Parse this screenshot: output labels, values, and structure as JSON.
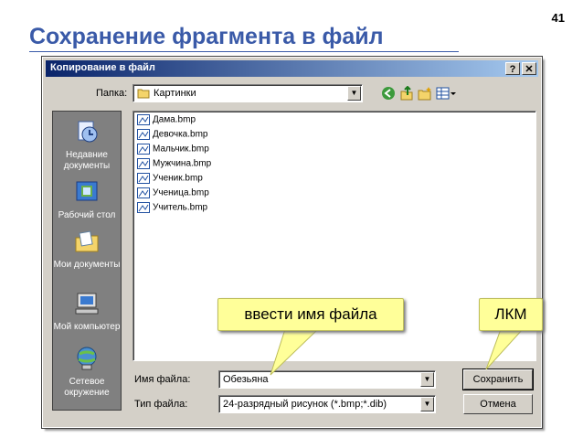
{
  "slide": {
    "title": "Сохранение фрагмента в файл",
    "number": "41"
  },
  "dialog": {
    "title": "Копирование в файл",
    "help_button": "?",
    "close_button": "✕",
    "folder_label": "Папка:",
    "folder_value": "Картинки",
    "places": [
      {
        "label": "Недавние документы",
        "icon": "recent-documents-icon"
      },
      {
        "label": "Рабочий стол",
        "icon": "desktop-icon"
      },
      {
        "label": "Мои документы",
        "icon": "my-documents-icon"
      },
      {
        "label": "Мой компьютер",
        "icon": "my-computer-icon"
      },
      {
        "label": "Сетевое окружение",
        "icon": "network-icon"
      }
    ],
    "files": [
      "Дама.bmp",
      "Девочка.bmp",
      "Мальчик.bmp",
      "Мужчина.bmp",
      "Ученик.bmp",
      "Ученица.bmp",
      "Учитель.bmp"
    ],
    "filename_label": "Имя файла:",
    "filename_value": "Обезьяна",
    "filetype_label": "Тип файла:",
    "filetype_value": "24-разрядный рисунок (*.bmp;*.dib)",
    "save_button": "Сохранить",
    "cancel_button": "Отмена"
  },
  "callouts": {
    "enter_name": "ввести имя файла",
    "click": "ЛКМ"
  },
  "colors": {
    "title": "#3a5aa8",
    "callout": "#ffff99",
    "dialog": "#d4d0c8",
    "titlebar": "#0a246a"
  }
}
